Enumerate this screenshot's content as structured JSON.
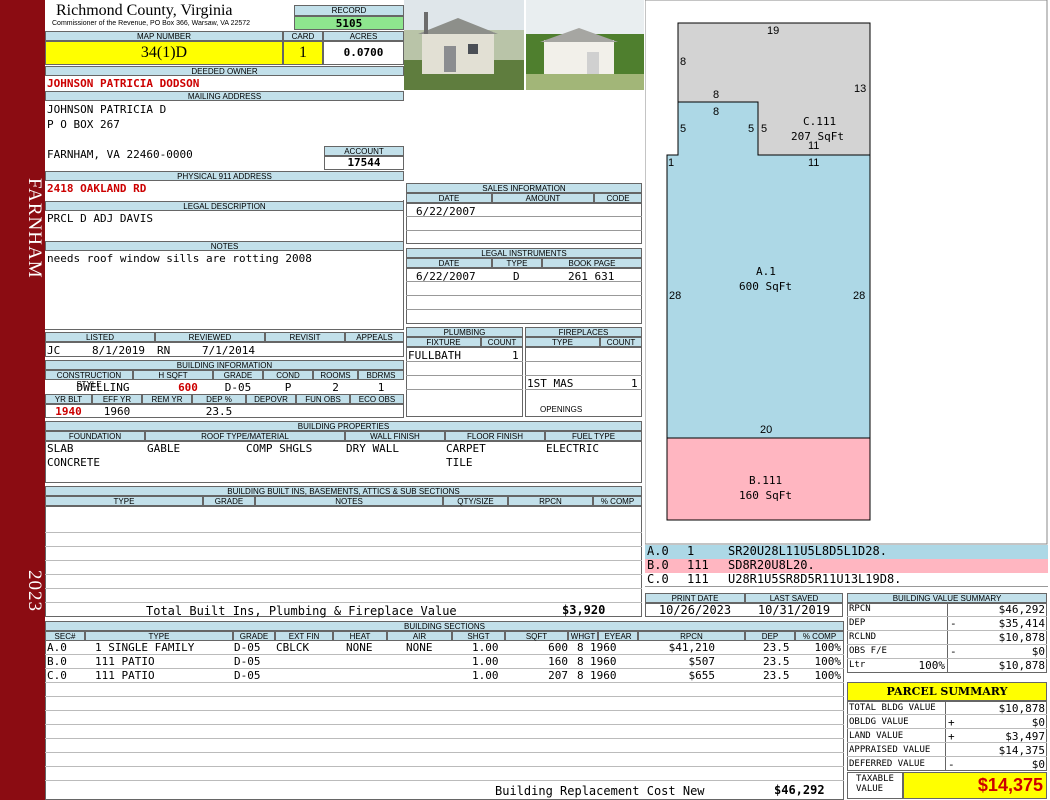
{
  "sidebar": {
    "town": "FARNHAM",
    "year": "2023"
  },
  "header": {
    "county": "Richmond County, Virginia",
    "address": "Commissioner of the Revenue, PO Box 366, Warsaw, VA 22572",
    "record_label": "RECORD",
    "record": "5105",
    "map_label": "MAP NUMBER",
    "map": "34(1)D",
    "card_label": "CARD",
    "card": "1",
    "acres_label": "ACRES",
    "acres": "0.0700"
  },
  "owner": {
    "deeded_label": "DEEDED OWNER",
    "deeded": "JOHNSON PATRICIA DODSON",
    "mailing_label": "MAILING ADDRESS",
    "line1": "JOHNSON PATRICIA D",
    "line2": "P O BOX 267",
    "line3": "FARNHAM, VA 22460-0000",
    "account_label": "ACCOUNT",
    "account": "17544"
  },
  "physical": {
    "label": "PHYSICAL 911 ADDRESS",
    "value": "2418 OAKLAND RD"
  },
  "legal": {
    "label": "LEGAL DESCRIPTION",
    "value": "PRCL D ADJ DAVIS"
  },
  "notes": {
    "label": "NOTES",
    "value": "needs roof window sills are rotting 2008"
  },
  "review": {
    "listed_label": "LISTED",
    "reviewed_label": "REVIEWED",
    "revisit_label": "REVISIT",
    "appeals_label": "APPEALS",
    "listed_by": "JC",
    "listed_date": "8/1/2019",
    "reviewed_by": "RN",
    "reviewed_date": "7/1/2014"
  },
  "building_info": {
    "label": "BUILDING INFORMATION",
    "h_style": "CONSTRUCTION STYLE",
    "h_sqft": "H SQFT",
    "h_grade": "GRADE",
    "h_cond": "COND",
    "h_rooms": "ROOMS",
    "h_bdrms": "BDRMS",
    "style": "DWELLING",
    "sqft": "600",
    "grade": "D-05",
    "cond": "P",
    "rooms": "2",
    "bdrms": "1",
    "h_yrblt": "YR BLT",
    "h_effyr": "EFF YR",
    "h_remyr": "REM YR",
    "h_dep": "DEP %",
    "h_depovr": "DEPOVR",
    "h_funobs": "FUN OBS",
    "h_ecoobs": "ECO OBS",
    "yrblt": "1940",
    "effyr": "1960",
    "dep": "23.5"
  },
  "sales": {
    "label": "SALES INFORMATION",
    "h_date": "DATE",
    "h_amount": "AMOUNT",
    "h_code": "CODE",
    "date": "6/22/2007"
  },
  "instruments": {
    "label": "LEGAL INSTRUMENTS",
    "h_date": "DATE",
    "h_type": "TYPE",
    "h_book": "BOOK PAGE",
    "date": "6/22/2007",
    "type": "D",
    "book": "261 631"
  },
  "plumbing": {
    "label": "PLUMBING",
    "h_fixture": "FIXTURE",
    "h_count": "COUNT",
    "fixture": "FULLBATH",
    "count": "1"
  },
  "fireplaces": {
    "label": "FIREPLACES",
    "h_type": "TYPE",
    "h_count": "COUNT",
    "type": "1ST MAS",
    "count": "1",
    "openings": "OPENINGS"
  },
  "properties": {
    "label": "BUILDING PROPERTIES",
    "h_foundation": "FOUNDATION",
    "h_roof": "ROOF TYPE/MATERIAL",
    "h_wall": "WALL FINISH",
    "h_floor": "FLOOR FINISH",
    "h_fuel": "FUEL TYPE",
    "found1": "SLAB",
    "found2": "CONCRETE",
    "roof1": "GABLE",
    "roof2": "COMP SHGLS",
    "wall": "DRY WALL",
    "floor1": "CARPET",
    "floor2": "TILE",
    "fuel": "ELECTRIC"
  },
  "builtins": {
    "label": "BUILDING BUILT INS, BASEMENTS, ATTICS & SUB SECTIONS",
    "h_type": "TYPE",
    "h_grade": "GRADE",
    "h_notes": "NOTES",
    "h_qty": "QTY/SIZE",
    "h_rpcn": "RPCN",
    "h_comp": "% COMP",
    "total_label": "Total Built Ins, Plumbing & Fireplace Value",
    "total": "$3,920"
  },
  "sketch": {
    "top": "19",
    "left_top": "8",
    "right_top": "13",
    "step_top": "8",
    "step_inner": "8",
    "l5a": "5",
    "l5b": "5",
    "l5c": "5",
    "c_label": "C.111",
    "c_area": "207 SqFt",
    "c11a": "11",
    "c11b": "11",
    "one": "1",
    "a_label": "A.1",
    "a_area": "600 SqFt",
    "l28": "28",
    "r28": "28",
    "mid20": "20",
    "b_label": "B.111",
    "b_area": "160 SqFt"
  },
  "codes": [
    {
      "id": "A.0",
      "n": "1",
      "code": "SR20U28L11U5L8D5L1D28."
    },
    {
      "id": "B.0",
      "n": "111",
      "code": "SD8R20U8L20."
    },
    {
      "id": "C.0",
      "n": "111",
      "code": "U28R1U5SR8D5R11U13L19D8."
    }
  ],
  "dates": {
    "print_label": "PRINT DATE",
    "print": "10/26/2023",
    "saved_label": "LAST SAVED",
    "saved": "10/31/2019"
  },
  "sections": {
    "label": "BUILDING SECTIONS",
    "headers": [
      "SEC#",
      "TYPE",
      "GRADE",
      "EXT FIN",
      "HEAT",
      "AIR",
      "SHGT",
      "SQFT",
      "WHGT",
      "EYEAR",
      "RPCN",
      "DEP",
      "% COMP"
    ],
    "rows": [
      [
        "A.0",
        "1 SINGLE FAMILY",
        "D-05",
        "CBLCK",
        "NONE",
        "NONE",
        "1.00",
        "600",
        "8",
        "1960",
        "$41,210",
        "23.5",
        "100%"
      ],
      [
        "B.0",
        "111 PATIO",
        "D-05",
        "",
        "",
        "",
        "1.00",
        "160",
        "8",
        "1960",
        "$507",
        "23.5",
        "100%"
      ],
      [
        "C.0",
        "111 PATIO",
        "D-05",
        "",
        "",
        "",
        "1.00",
        "207",
        "8",
        "1960",
        "$655",
        "23.5",
        "100%"
      ]
    ],
    "brcn_label": "Building Replacement Cost New",
    "brcn": "$46,292"
  },
  "bvs": {
    "label": "BUILDING VALUE SUMMARY",
    "rpcn_l": "RPCN",
    "rpcn": "$46,292",
    "dep_l": "DEP",
    "dep_s": "-",
    "dep": "$35,414",
    "rclnd_l": "RCLND",
    "rclnd": "$10,878",
    "obs_l": "OBS F/E",
    "obs_s": "-",
    "obs": "$0",
    "ltr_l": "Ltr",
    "ltr_p": "100%",
    "ltr": "$10,878"
  },
  "parcel": {
    "label": "PARCEL SUMMARY",
    "tb_l": "TOTAL BLDG VALUE",
    "tb": "$10,878",
    "ob_l": "OBLDG VALUE",
    "ob_s": "+",
    "ob": "$0",
    "lv_l": "LAND VALUE",
    "lv_s": "+",
    "lv": "$3,497",
    "ap_l": "APPRAISED VALUE",
    "ap": "$14,375",
    "df_l": "DEFERRED VALUE",
    "df_s": "-",
    "df": "$0",
    "tx_l1": "TAXABLE",
    "tx_l2": "VALUE",
    "tx": "$14,375"
  },
  "colors": {
    "sidebar": "#8b0c12",
    "header": "#c2e0ea",
    "yellow": "#ffff00",
    "green": "#8ee68e",
    "blue": "#add8e6",
    "pink": "#ffb6c1",
    "gray": "#d3d3d3"
  }
}
